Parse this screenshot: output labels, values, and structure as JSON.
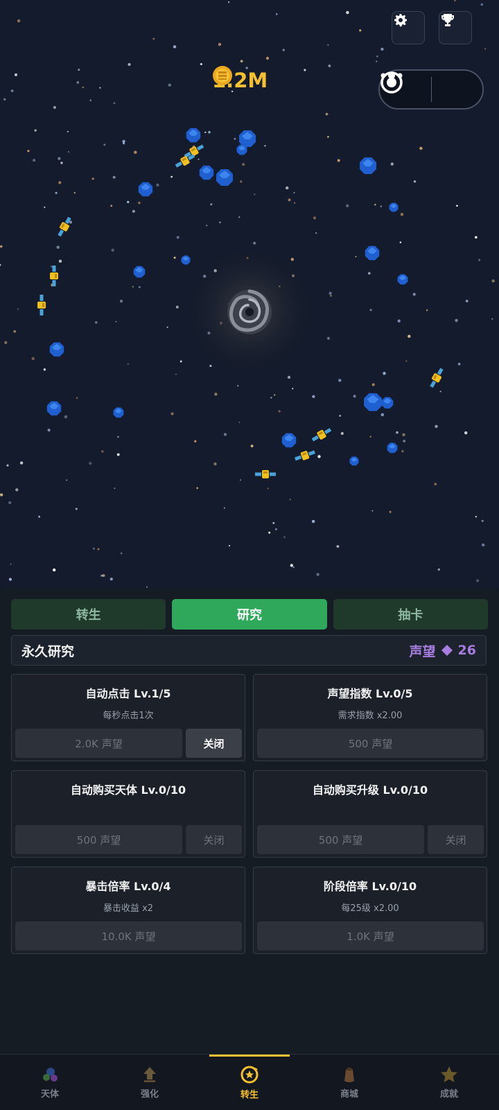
{
  "header": {
    "coins_value": "1.2M",
    "settings_icon": "gear-icon",
    "trophy_icon": "trophy-icon",
    "menu_icon": "more-dots-icon",
    "close_icon": "target-close-icon"
  },
  "tabs": [
    {
      "label": "转生",
      "active": false
    },
    {
      "label": "研究",
      "active": true
    },
    {
      "label": "抽卡",
      "active": false
    }
  ],
  "section": {
    "title": "永久研究",
    "currency_label": "声望",
    "currency_value": "26"
  },
  "cards": [
    {
      "title": "自动点击  Lv.1/5",
      "subtitle": "每秒点击1次",
      "cost": "2.0K 声望",
      "toggle": "关闭",
      "toggle_enabled": true
    },
    {
      "title": "声望指数  Lv.0/5",
      "subtitle": "需求指数 x2.00",
      "cost": "500 声望"
    },
    {
      "title": "自动购买天体  Lv.0/10",
      "subtitle": "",
      "cost": "500 声望",
      "toggle": "关闭",
      "toggle_enabled": false
    },
    {
      "title": "自动购买升级  Lv.0/10",
      "subtitle": "",
      "cost": "500 声望",
      "toggle": "关闭",
      "toggle_enabled": false
    },
    {
      "title": "暴击倍率  Lv.0/4",
      "subtitle": "暴击收益 x2",
      "cost": "10.0K 声望"
    },
    {
      "title": "阶段倍率  Lv.0/10",
      "subtitle": "每25级 x2.00",
      "cost": "1.0K 声望"
    }
  ],
  "nav": [
    {
      "label": "天体",
      "icon": "planets-icon",
      "active": false
    },
    {
      "label": "强化",
      "icon": "upgrade-icon",
      "active": false
    },
    {
      "label": "转生",
      "icon": "rebirth-icon",
      "active": true
    },
    {
      "label": "商城",
      "icon": "shop-bag-icon",
      "active": false
    },
    {
      "label": "成就",
      "icon": "star-icon",
      "active": false
    }
  ],
  "colors": {
    "accent_green": "#2fa85b",
    "gold": "#f5c030",
    "prestige_purple": "#a87de0",
    "space_bg": "#141b2c"
  }
}
